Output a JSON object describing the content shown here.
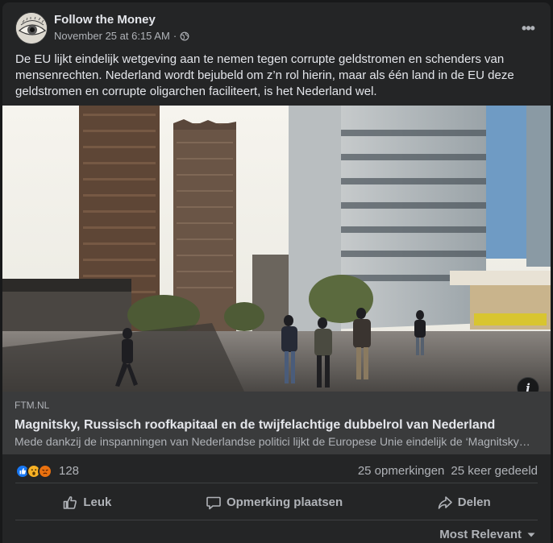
{
  "post": {
    "page_name": "Follow the Money",
    "timestamp": "November 25 at 6:15 AM",
    "separator": "·",
    "privacy_icon": "globe-icon",
    "more_icon": "more-horizontal-icon",
    "more_label": "•••",
    "text": "De EU lijkt eindelijk wetgeving aan te nemen tegen corrupte geldstromen en schenders van mensenrechten. Nederland wordt bejubeld om z’n rol hierin, maar als één land in de EU deze geldstromen en corrupte oligarchen faciliteert, is het Nederland wel."
  },
  "link": {
    "info_label": "i",
    "domain": "FTM.NL",
    "title": "Magnitsky, Russisch roofkapitaal en de twijfelachtige dubbelrol van Nederland",
    "description": "Mede dankzij de inspanningen van Nederlandse politici lijkt de Europese Unie eindelijk de ‘Magnitsky-wet’ te gaan invoeren. Maar tegelijk is Nederland een knooppunt voor Russisch roofkapitaal."
  },
  "stats": {
    "reaction_icons": [
      "like-icon",
      "wow-icon",
      "angry-icon"
    ],
    "reaction_count": "128",
    "comments": "25 opmerkingen",
    "shares": "25 keer gedeeld"
  },
  "actions": {
    "like": "Leuk",
    "comment": "Opmerking plaatsen",
    "share": "Delen"
  },
  "comments_sort": {
    "label": "Most Relevant"
  },
  "colors": {
    "background": "#18191a",
    "card": "#242526",
    "link_panel": "#3a3b3c",
    "primary_text": "#e4e6eb",
    "secondary_text": "#b0b3b8",
    "like_blue": "#1877f2"
  }
}
